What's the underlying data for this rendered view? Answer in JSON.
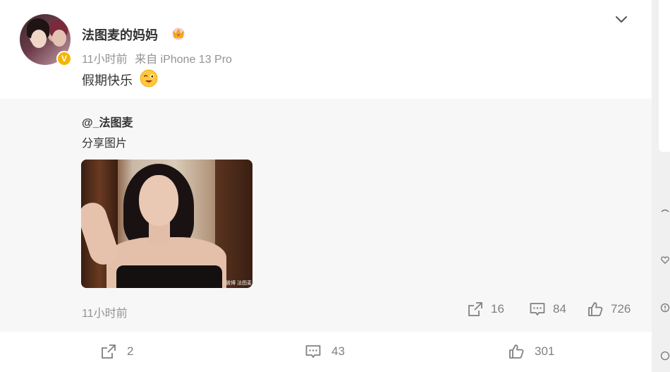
{
  "post": {
    "username": "法图麦的妈妈",
    "time": "11小时前",
    "source": "来自 iPhone 13 Pro",
    "text": "假期快乐",
    "verified_badge": "V"
  },
  "repost": {
    "author": "@_法图麦",
    "text": "分享图片",
    "photo_watermark": "微博 法图麦",
    "time": "11小时前",
    "stats": {
      "reposts": "16",
      "comments": "84",
      "likes": "726"
    }
  },
  "toolbar": {
    "reposts": "2",
    "comments": "43",
    "likes": "301"
  },
  "icons": {
    "crown": "crown-icon",
    "wink": "wink-emoji-icon",
    "share": "share-icon",
    "comment": "comment-icon",
    "like": "thumbs-up-icon",
    "chevron": "chevron-down-icon"
  },
  "colors": {
    "accent": "#f5b400",
    "muted": "#939393",
    "repost_bg": "#f7f7f7"
  }
}
